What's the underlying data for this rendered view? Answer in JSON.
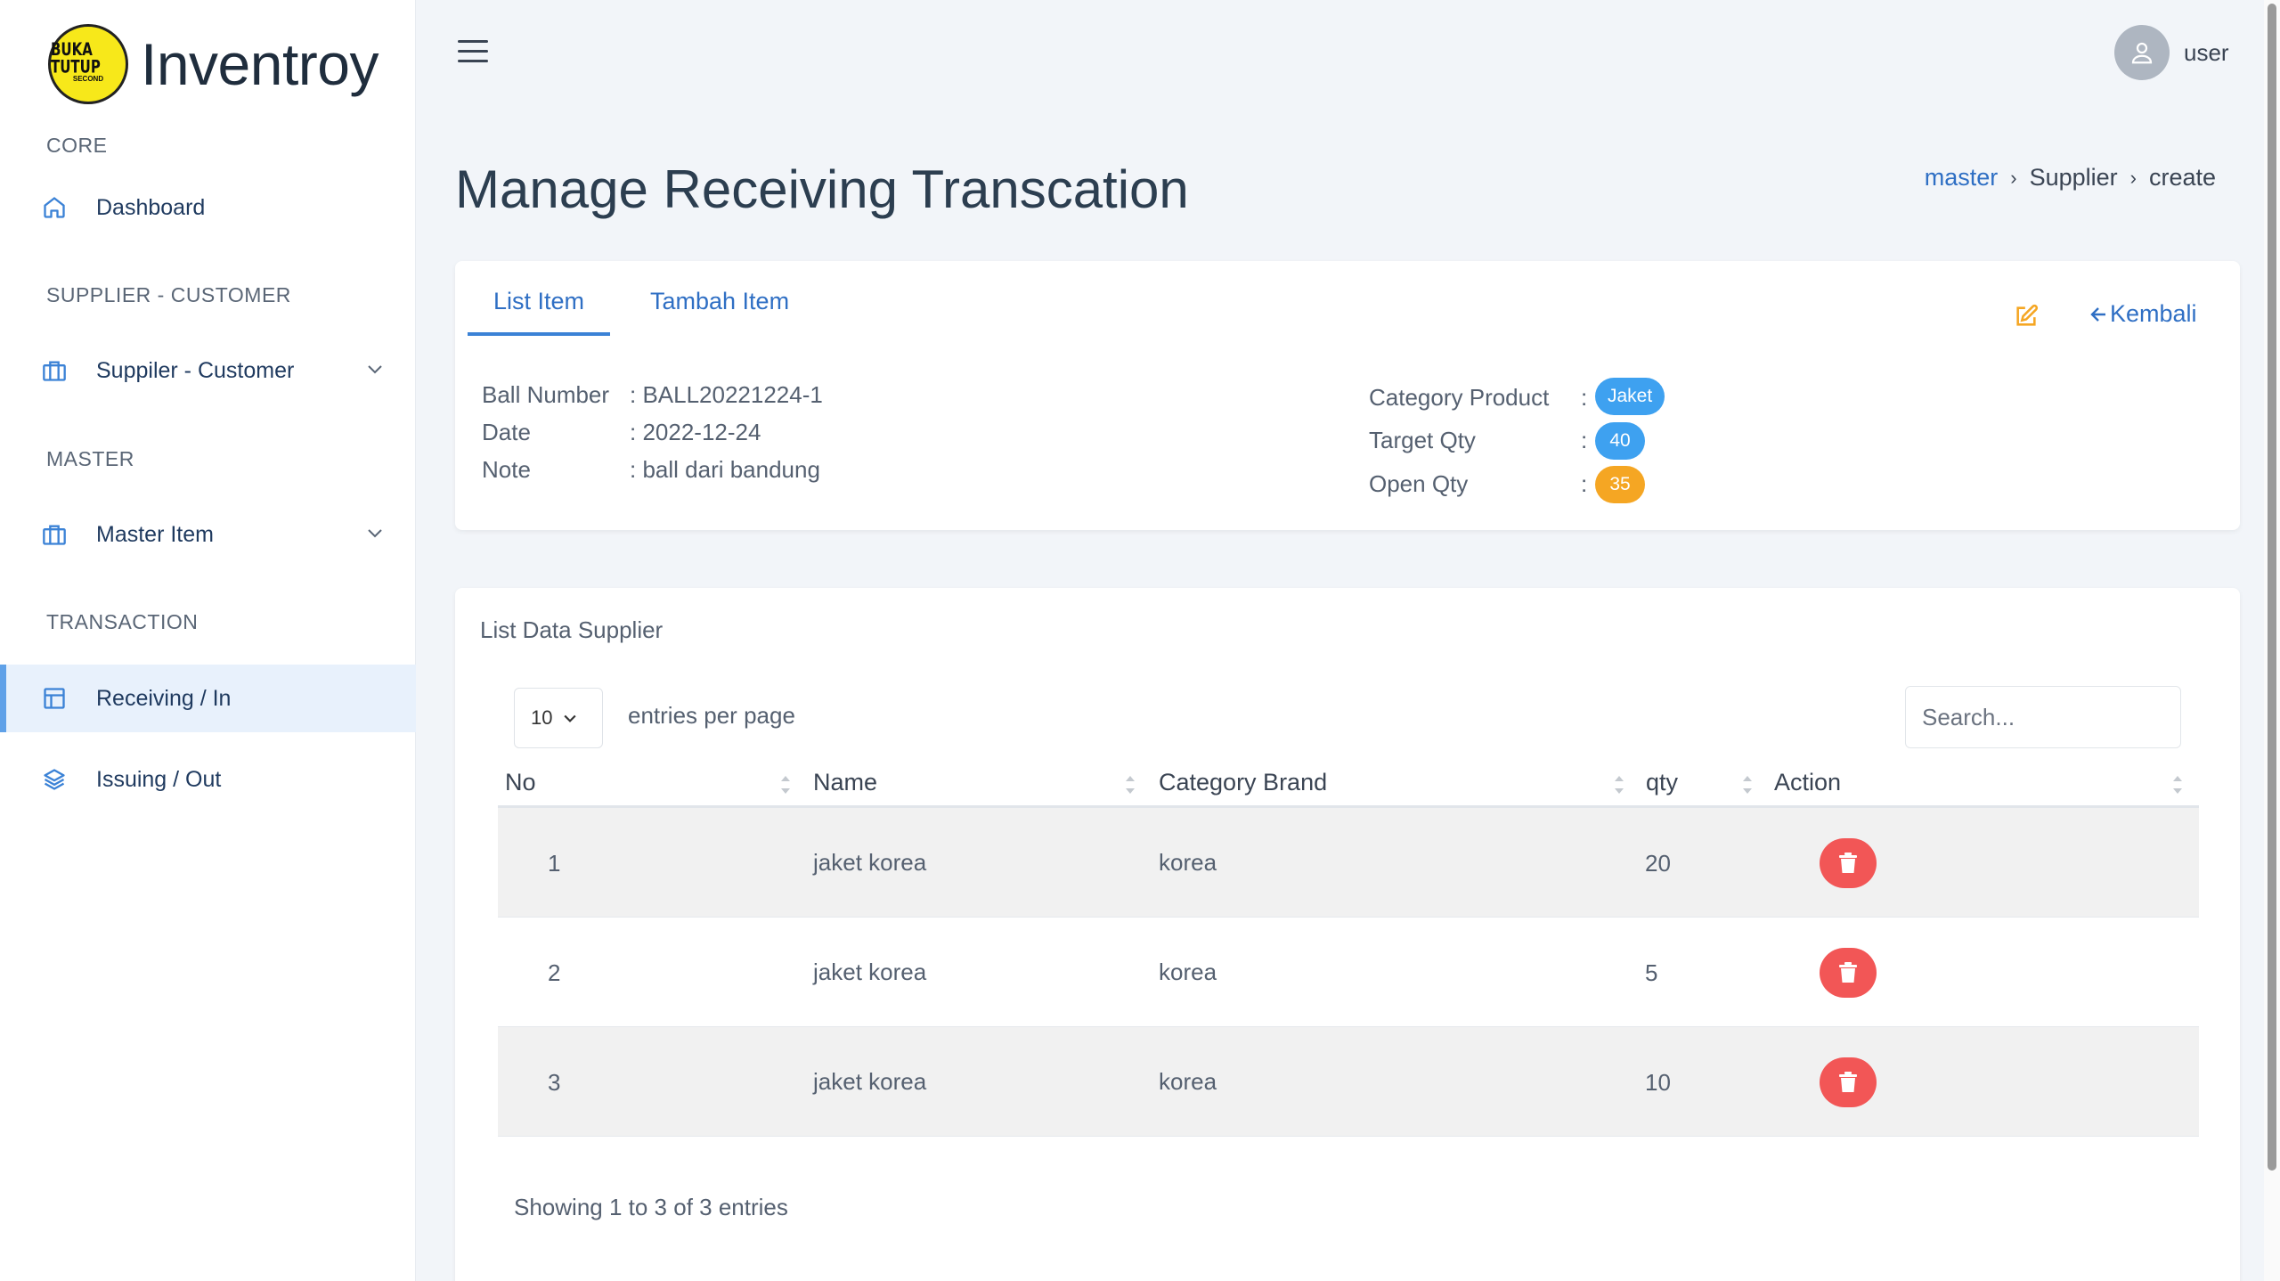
{
  "brand": {
    "logo_line1": "BUKA TUTUP",
    "logo_line2": "SECOND",
    "name": "Inventroy"
  },
  "sidebar": {
    "sections": [
      "CORE",
      "SUPPLIER - CUSTOMER",
      "MASTER",
      "TRANSACTION"
    ],
    "items": [
      {
        "label": "Dashboard",
        "icon": "home-icon"
      },
      {
        "label": "Suppiler - Customer",
        "icon": "briefcase-icon"
      },
      {
        "label": "Master Item",
        "icon": "briefcase-icon"
      },
      {
        "label": "Receiving / In",
        "icon": "layout-icon"
      },
      {
        "label": "Issuing / Out",
        "icon": "layers-icon"
      }
    ]
  },
  "header": {
    "user": "user"
  },
  "page": {
    "title": "Manage Receiving Transcation"
  },
  "breadcrumb": {
    "items": [
      "master",
      "Supplier",
      "create"
    ]
  },
  "tabs": [
    "List Item",
    "Tambah Item"
  ],
  "actions": {
    "back": "Kembali"
  },
  "info": {
    "ball_number_label": "Ball Number",
    "ball_number_value": ": BALL20221224-1",
    "date_label": "Date",
    "date_value": ": 2022-12-24",
    "note_label": "Note",
    "note_value": ": ball dari bandung",
    "category_label": "Category Product",
    "category_value": "Jaket",
    "target_label": "Target Qty",
    "target_value": "40",
    "open_label": "Open Qty",
    "open_value": "35",
    "colon": ":"
  },
  "list": {
    "title": "List Data Supplier",
    "per_page": "10",
    "per_page_label": "entries per page",
    "search_placeholder": "Search...",
    "columns": [
      "No",
      "Name",
      "Category Brand",
      "qty",
      "Action"
    ],
    "rows": [
      {
        "no": "1",
        "name": "jaket korea",
        "brand": "korea",
        "qty": "20"
      },
      {
        "no": "2",
        "name": "jaket korea",
        "brand": "korea",
        "qty": "5"
      },
      {
        "no": "3",
        "name": "jaket korea",
        "brand": "korea",
        "qty": "10"
      }
    ],
    "footer": "Showing 1 to 3 of 3 entries"
  },
  "colors": {
    "primary": "#2f6fc4",
    "badge_blue": "#3ea1f0",
    "badge_orange": "#f5a623",
    "danger": "#f25656",
    "edit": "#f5a623"
  }
}
